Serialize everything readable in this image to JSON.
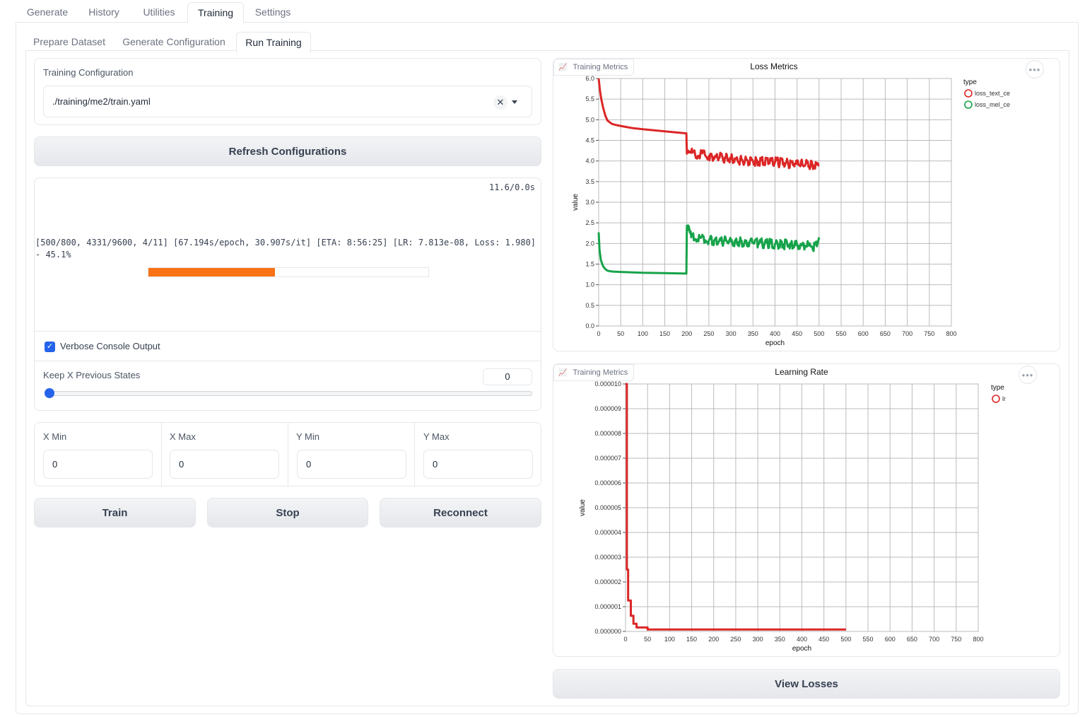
{
  "top_tabs": [
    "Generate",
    "History",
    "Utilities",
    "Training",
    "Settings"
  ],
  "sub_tabs": [
    "Prepare Dataset",
    "Generate Configuration",
    "Run Training"
  ],
  "config": {
    "label": "Training Configuration",
    "value": "./training/me2/train.yaml"
  },
  "refresh_label": "Refresh Configurations",
  "console": {
    "timer": "11.6/0.0s",
    "line1": "[500/800, 4331/9600, 4/11] [67.194s/epoch, 30.907s/it] [ETA: 8:56:25] [LR: 7.813e-08, Loss: 1.980]",
    "line2": "- 45.1%",
    "progress": 0.451,
    "progress_color": "#f97316"
  },
  "verbose": {
    "label": "Verbose Console Output",
    "checked": true
  },
  "keep_states": {
    "label": "Keep X Previous States",
    "value": "0"
  },
  "bounds": {
    "x_min": {
      "label": "X Min",
      "value": "0"
    },
    "x_max": {
      "label": "X Max",
      "value": "0"
    },
    "y_min": {
      "label": "Y Min",
      "value": "0"
    },
    "y_max": {
      "label": "Y Max",
      "value": "0"
    }
  },
  "buttons": {
    "train": "Train",
    "stop": "Stop",
    "reconnect": "Reconnect",
    "view_losses": "View Losses"
  },
  "chart_tag": "Training Metrics",
  "chart_data": [
    {
      "type": "line",
      "title": "Loss Metrics",
      "xlabel": "epoch",
      "ylabel": "value",
      "legend_title": "type",
      "legend_position": "top-right",
      "xlim": [
        0,
        800
      ],
      "ylim": [
        0.0,
        6.0
      ],
      "x_ticks": [
        0,
        50,
        100,
        150,
        200,
        250,
        300,
        350,
        400,
        450,
        500,
        550,
        600,
        650,
        700,
        750,
        800
      ],
      "y_ticks": [
        "0.0",
        "0.5",
        "1.0",
        "1.5",
        "2.0",
        "2.5",
        "3.0",
        "3.5",
        "4.0",
        "4.5",
        "5.0",
        "5.5",
        "6.0"
      ],
      "grid": true,
      "series": [
        {
          "name": "loss_text_ce",
          "color": "#dc2626",
          "x": [
            0,
            3,
            6,
            10,
            15,
            20,
            30,
            40,
            50,
            75,
            100,
            150,
            199,
            200,
            210,
            250,
            300,
            350,
            400,
            450,
            500
          ],
          "y": [
            6.0,
            5.7,
            5.5,
            5.3,
            5.1,
            4.98,
            4.9,
            4.87,
            4.85,
            4.8,
            4.77,
            4.72,
            4.67,
            4.18,
            4.2,
            4.12,
            4.05,
            4.0,
            3.97,
            3.93,
            3.9
          ]
        },
        {
          "name": "loss_mel_ce",
          "color": "#16a34a",
          "x": [
            0,
            2,
            5,
            10,
            15,
            20,
            30,
            50,
            100,
            150,
            199,
            200,
            210,
            250,
            300,
            350,
            400,
            450,
            495,
            500
          ],
          "y": [
            2.27,
            1.85,
            1.6,
            1.45,
            1.38,
            1.34,
            1.32,
            1.31,
            1.29,
            1.28,
            1.27,
            2.43,
            2.15,
            2.08,
            2.05,
            2.02,
            1.99,
            1.96,
            1.93,
            2.15
          ]
        }
      ]
    },
    {
      "type": "line",
      "title": "Learning Rate",
      "xlabel": "epoch",
      "ylabel": "value",
      "legend_title": "type",
      "legend_position": "top-right",
      "xlim": [
        0,
        800
      ],
      "ylim": [
        0.0,
        1e-05
      ],
      "x_ticks": [
        0,
        50,
        100,
        150,
        200,
        250,
        300,
        350,
        400,
        450,
        500,
        550,
        600,
        650,
        700,
        750,
        800
      ],
      "y_ticks": [
        "0.000000",
        "0.000001",
        "0.000002",
        "0.000003",
        "0.000004",
        "0.000005",
        "0.000006",
        "0.000007",
        "0.000008",
        "0.000009",
        "0.000010"
      ],
      "grid": true,
      "series": [
        {
          "name": "lr",
          "color": "#dc2626",
          "x": [
            0,
            3,
            3,
            6,
            6,
            12,
            12,
            18,
            18,
            25,
            25,
            50,
            50,
            500
          ],
          "y": [
            1e-05,
            1e-05,
            2.5e-06,
            2.5e-06,
            1.25e-06,
            1.25e-06,
            6.3e-07,
            6.3e-07,
            3.1e-07,
            3.1e-07,
            1.6e-07,
            1.6e-07,
            8e-08,
            8e-08
          ]
        }
      ]
    }
  ]
}
